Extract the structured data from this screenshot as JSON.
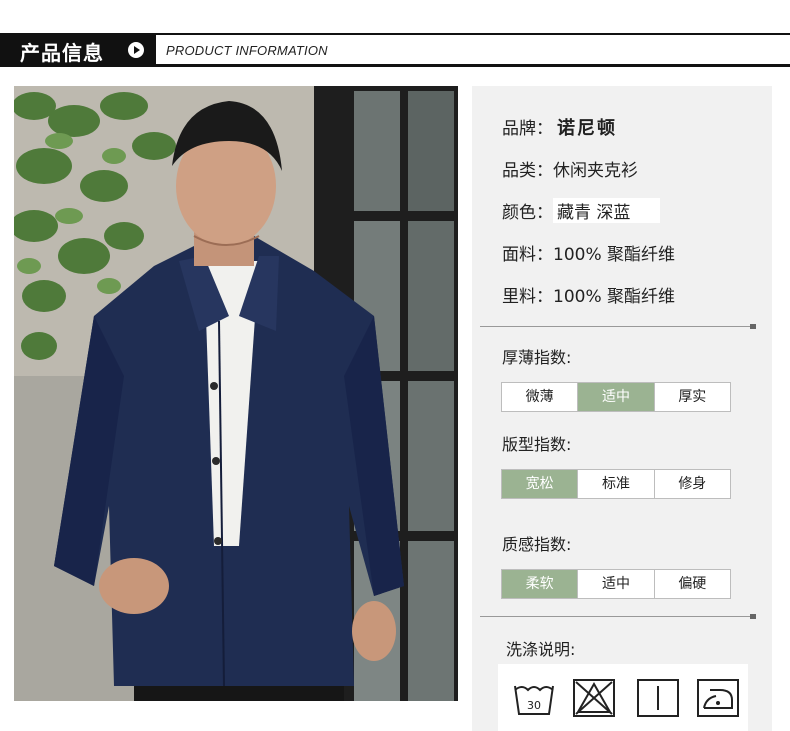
{
  "header": {
    "title": "产品信息",
    "subtitle": "PRODUCT INFORMATION"
  },
  "photo": {
    "alt_icon": "model-photo"
  },
  "info": {
    "brand_label": "品牌：",
    "brand_value": "诺尼顿",
    "category_label": "品类：",
    "category_value": "休闲夹克衫",
    "color_label": "颜色：",
    "color_value": "藏青 深蓝",
    "fabric_label": "面料：",
    "fabric_value": "100% 聚酯纤维",
    "lining_label": "里料：",
    "lining_value": "100% 聚酯纤维"
  },
  "indices": [
    {
      "title": "厚薄指数:",
      "options": [
        "微薄",
        "适中",
        "厚实"
      ],
      "selected": 1
    },
    {
      "title": "版型指数:",
      "options": [
        "宽松",
        "标准",
        "修身"
      ],
      "selected": 0
    },
    {
      "title": "质感指数:",
      "options": [
        "柔软",
        "适中",
        "偏硬"
      ],
      "selected": 0
    }
  ],
  "wash": {
    "title": "洗涤说明:",
    "temp": "30",
    "icons": [
      "wash-30-icon",
      "no-bleach-icon",
      "hang-dry-icon",
      "low-iron-icon"
    ]
  },
  "colors": {
    "accent": "#9bb392",
    "panel_bg": "#f1f1f1",
    "header_bg": "#111111"
  }
}
